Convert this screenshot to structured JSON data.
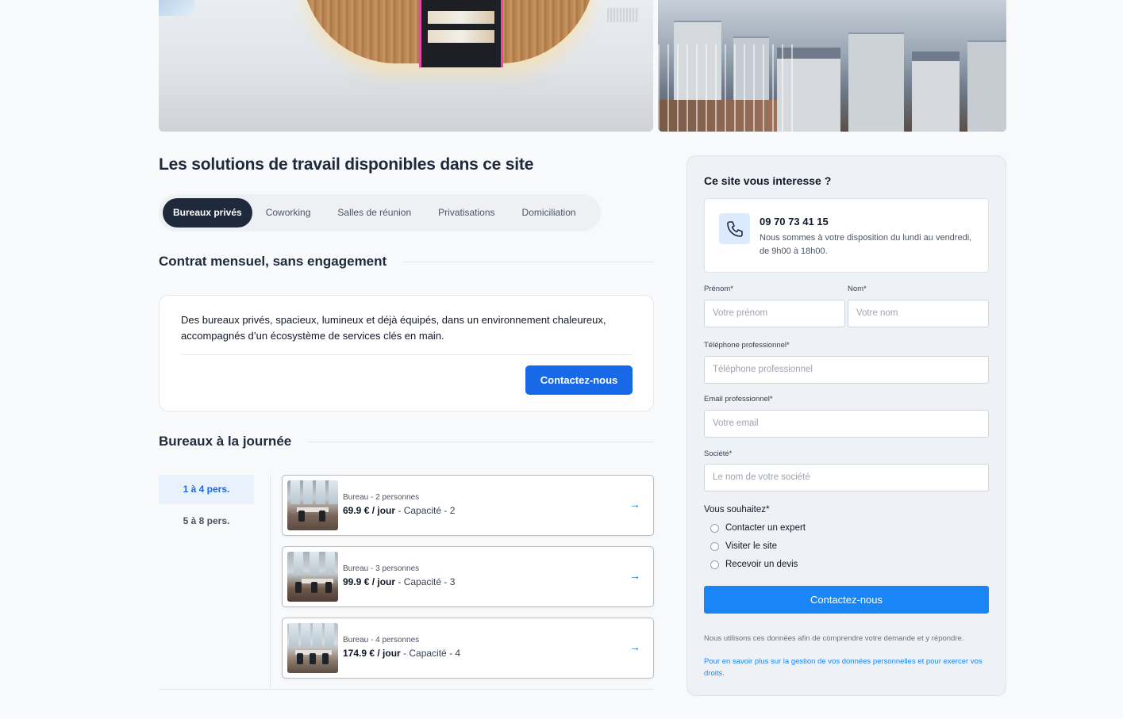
{
  "section_title": "Les solutions de travail disponibles dans ce site",
  "tabs": [
    {
      "label": "Bureaux privés",
      "active": true
    },
    {
      "label": "Coworking",
      "active": false
    },
    {
      "label": "Salles de réunion",
      "active": false
    },
    {
      "label": "Privatisations",
      "active": false
    },
    {
      "label": "Domiciliation",
      "active": false
    }
  ],
  "contract": {
    "heading": "Contrat mensuel, sans engagement",
    "description": "Des bureaux privés, spacieux, lumineux et déjà équipés, dans un environnement chaleureux, accompagnés d’un écosystème de services clés en main.",
    "button": "Contactez-nous"
  },
  "journee": {
    "heading": "Bureaux à la journée",
    "capacity_filters": [
      {
        "label": "1 à 4 pers.",
        "active": true
      },
      {
        "label": "5 à 8 pers.",
        "active": false
      }
    ],
    "offices": [
      {
        "label": "Bureau - 2 personnes",
        "price": "69.9 € / jour",
        "capacity": " - Capacité - 2"
      },
      {
        "label": "Bureau - 3 personnes",
        "price": "99.9 € / jour",
        "capacity": " - Capacité - 3"
      },
      {
        "label": "Bureau - 4 personnes",
        "price": "174.9 € / jour",
        "capacity": " - Capacité - 4"
      }
    ]
  },
  "form": {
    "title": "Ce site vous interesse ?",
    "phone_number": "09 70 73 41 15",
    "phone_desc": "Nous sommes à votre disposition du lundi au vendredi, de 9h00 à 18h00.",
    "firstname_label": "Prénom*",
    "firstname_placeholder": "Votre prénom",
    "lastname_label": "Nom*",
    "lastname_placeholder": "Votre nom",
    "phone_label": "Téléphone professionnel*",
    "phone_placeholder": "Téléphone professionnel",
    "email_label": "Email professionnel*",
    "email_placeholder": "Votre email",
    "company_label": "Société*",
    "company_placeholder": "Le nom de votre société",
    "wish_label": "Vous souhaitez*",
    "options": [
      "Contacter un expert",
      "Visiter le site",
      "Recevoir un devis"
    ],
    "submit": "Contactez-nous",
    "legal": "Nous utilisons ces données afin de comprendre votre demande et y répondre.",
    "legal_link": "Pour en savoir plus sur la gestion de vos données personnelles et pour exercer vos droits."
  },
  "colors": {
    "primary": "#1769e8",
    "dark": "#1e293b",
    "form_button": "#1a86f5"
  }
}
